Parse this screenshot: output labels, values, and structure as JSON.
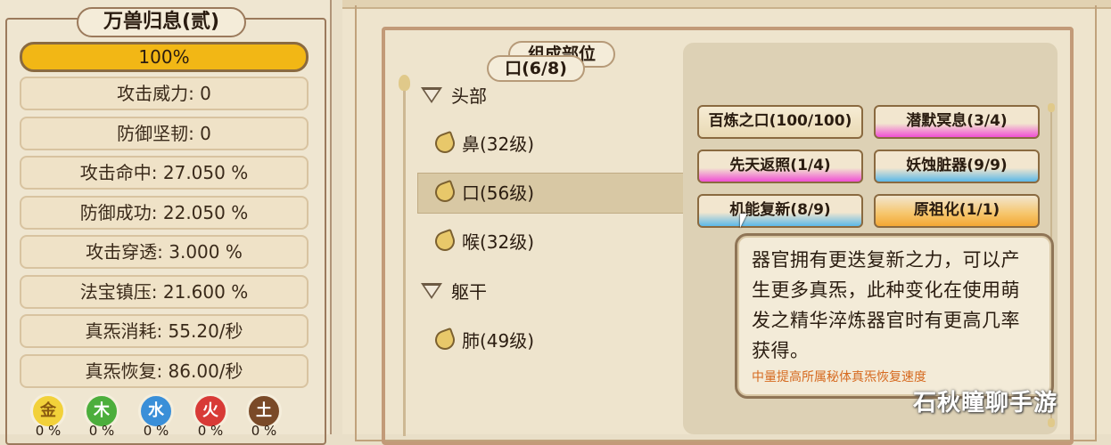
{
  "left_panel": {
    "title": "万兽归息(贰)",
    "progress": "100%",
    "stats": [
      "攻击威力: 0",
      "防御坚韧: 0",
      "攻击命中: 27.050 %",
      "防御成功: 22.050 %",
      "攻击穿透: 3.000 %",
      "法宝镇压: 21.600 %",
      "真炁消耗: 55.20/秒",
      "真炁恢复: 86.00/秒"
    ],
    "elements": [
      {
        "label": "金",
        "pct": "0 %",
        "color": "#f2d13a",
        "text_color": "#8a5a10"
      },
      {
        "label": "木",
        "pct": "0 %",
        "color": "#4cae3c",
        "text_color": "#ffffff"
      },
      {
        "label": "水",
        "pct": "0 %",
        "color": "#3a8fd8",
        "text_color": "#ffffff"
      },
      {
        "label": "火",
        "pct": "0 %",
        "color": "#d83a36",
        "text_color": "#ffffff"
      },
      {
        "label": "土",
        "pct": "0 %",
        "color": "#7a4a28",
        "text_color": "#ffffff"
      }
    ]
  },
  "composition": {
    "title": "组成部位",
    "categories": [
      {
        "label": "头部",
        "items": [
          "鼻(32级)",
          "口(56级)",
          "喉(32级)"
        ]
      },
      {
        "label": "躯干",
        "items": [
          "肺(49级)"
        ]
      }
    ],
    "selected_item": "口(56级)"
  },
  "skills": {
    "title": "口(6/8)",
    "buttons": [
      {
        "label": "百炼之口(100/100)",
        "style": "plain"
      },
      {
        "label": "潜默冥息(3/4)",
        "style": "pink"
      },
      {
        "label": "先天返照(1/4)",
        "style": "pink"
      },
      {
        "label": "妖蚀脏器(9/9)",
        "style": "blue"
      },
      {
        "label": "机能复新(8/9)",
        "style": "blue"
      },
      {
        "label": "原祖化(1/1)",
        "style": "orange"
      }
    ]
  },
  "tooltip": {
    "description": "器官拥有更迭复新之力，可以产生更多真炁，此种变化在使用萌发之精华淬炼器官时有更高几率获得。",
    "note": "中量提高所属秘体真炁恢复速度"
  },
  "watermark": "石秋瞳聊手游"
}
